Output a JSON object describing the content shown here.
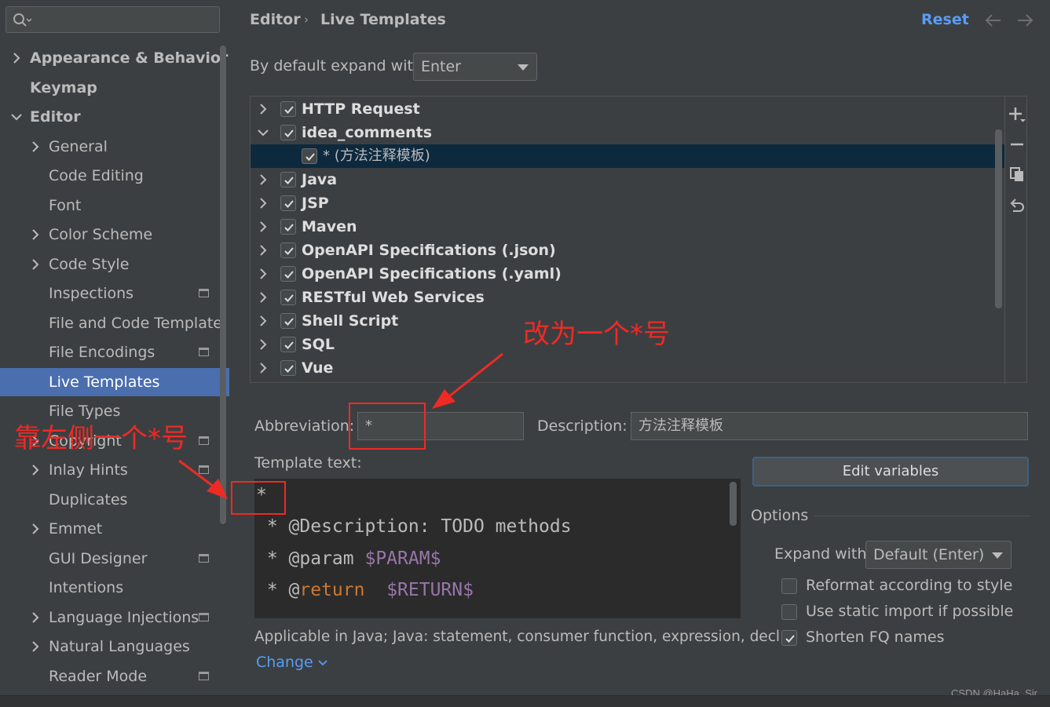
{
  "search": {
    "placeholder": ""
  },
  "breadcrumb": {
    "parent": "Editor",
    "separator": "›",
    "current": "Live Templates"
  },
  "toolbar": {
    "reset_label": "Reset"
  },
  "expand_setting": {
    "label": "By default expand with",
    "value": "Enter"
  },
  "sidebar": {
    "items": [
      {
        "label": "Appearance & Behavior"
      },
      {
        "label": "Keymap"
      },
      {
        "label": "Editor"
      },
      {
        "label": "General"
      },
      {
        "label": "Code Editing"
      },
      {
        "label": "Font"
      },
      {
        "label": "Color Scheme"
      },
      {
        "label": "Code Style"
      },
      {
        "label": "Inspections"
      },
      {
        "label": "File and Code Template"
      },
      {
        "label": "File Encodings"
      },
      {
        "label": "Live Templates"
      },
      {
        "label": "File Types"
      },
      {
        "label": "Copyright"
      },
      {
        "label": "Inlay Hints"
      },
      {
        "label": "Duplicates"
      },
      {
        "label": "Emmet"
      },
      {
        "label": "GUI Designer"
      },
      {
        "label": "Intentions"
      },
      {
        "label": "Language Injections"
      },
      {
        "label": "Natural Languages"
      },
      {
        "label": "Reader Mode"
      }
    ]
  },
  "tree": {
    "rows": [
      {
        "label": "HTTP Request"
      },
      {
        "label": "idea_comments"
      },
      {
        "label": "* (方法注释模板)"
      },
      {
        "label": "Java"
      },
      {
        "label": "JSP"
      },
      {
        "label": "Maven"
      },
      {
        "label": "OpenAPI Specifications (.json)"
      },
      {
        "label": "OpenAPI Specifications (.yaml)"
      },
      {
        "label": "RESTful Web Services"
      },
      {
        "label": "Shell Script"
      },
      {
        "label": "SQL"
      },
      {
        "label": "Vue"
      }
    ]
  },
  "form": {
    "abbreviation_label": "Abbreviation:",
    "abbreviation_value": "*",
    "description_label": "Description:",
    "description_value": "方法注释模板",
    "template_text_label": "Template text:"
  },
  "template": {
    "line1": "*",
    "line2": " * @Description: TODO methods",
    "line3_prefix": " * @param ",
    "line3_var": "$PARAM$",
    "line4_prefix": " * @",
    "line4_kw": "return",
    "line4_gap": "  ",
    "line4_var": "$RETURN$"
  },
  "applicable": {
    "text": "Applicable in Java; Java: statement, consumer function, expression, decl..",
    "change_label": "Change"
  },
  "options": {
    "edit_variables_label": "Edit variables",
    "title": "Options",
    "expand_with_label": "Expand with",
    "expand_with_value": "Default (Enter)",
    "reformat_label": "Reformat according to style",
    "static_import_label": "Use static import if possible",
    "shorten_fq_label": "Shorten FQ names",
    "reformat_checked": false,
    "static_import_checked": false,
    "shorten_fq_checked": true
  },
  "annotations": {
    "top_note": "改为一个*号",
    "left_note": "靠左侧一个*号"
  },
  "watermark": "CSDN @HaHa_Sir",
  "colors": {
    "background": "#3c3f41",
    "selection": "#4b6eaf",
    "tree_selection": "#0d293e",
    "link": "#589df6",
    "annotation": "#ee2a25",
    "editor_bg": "#2b2b2b"
  }
}
